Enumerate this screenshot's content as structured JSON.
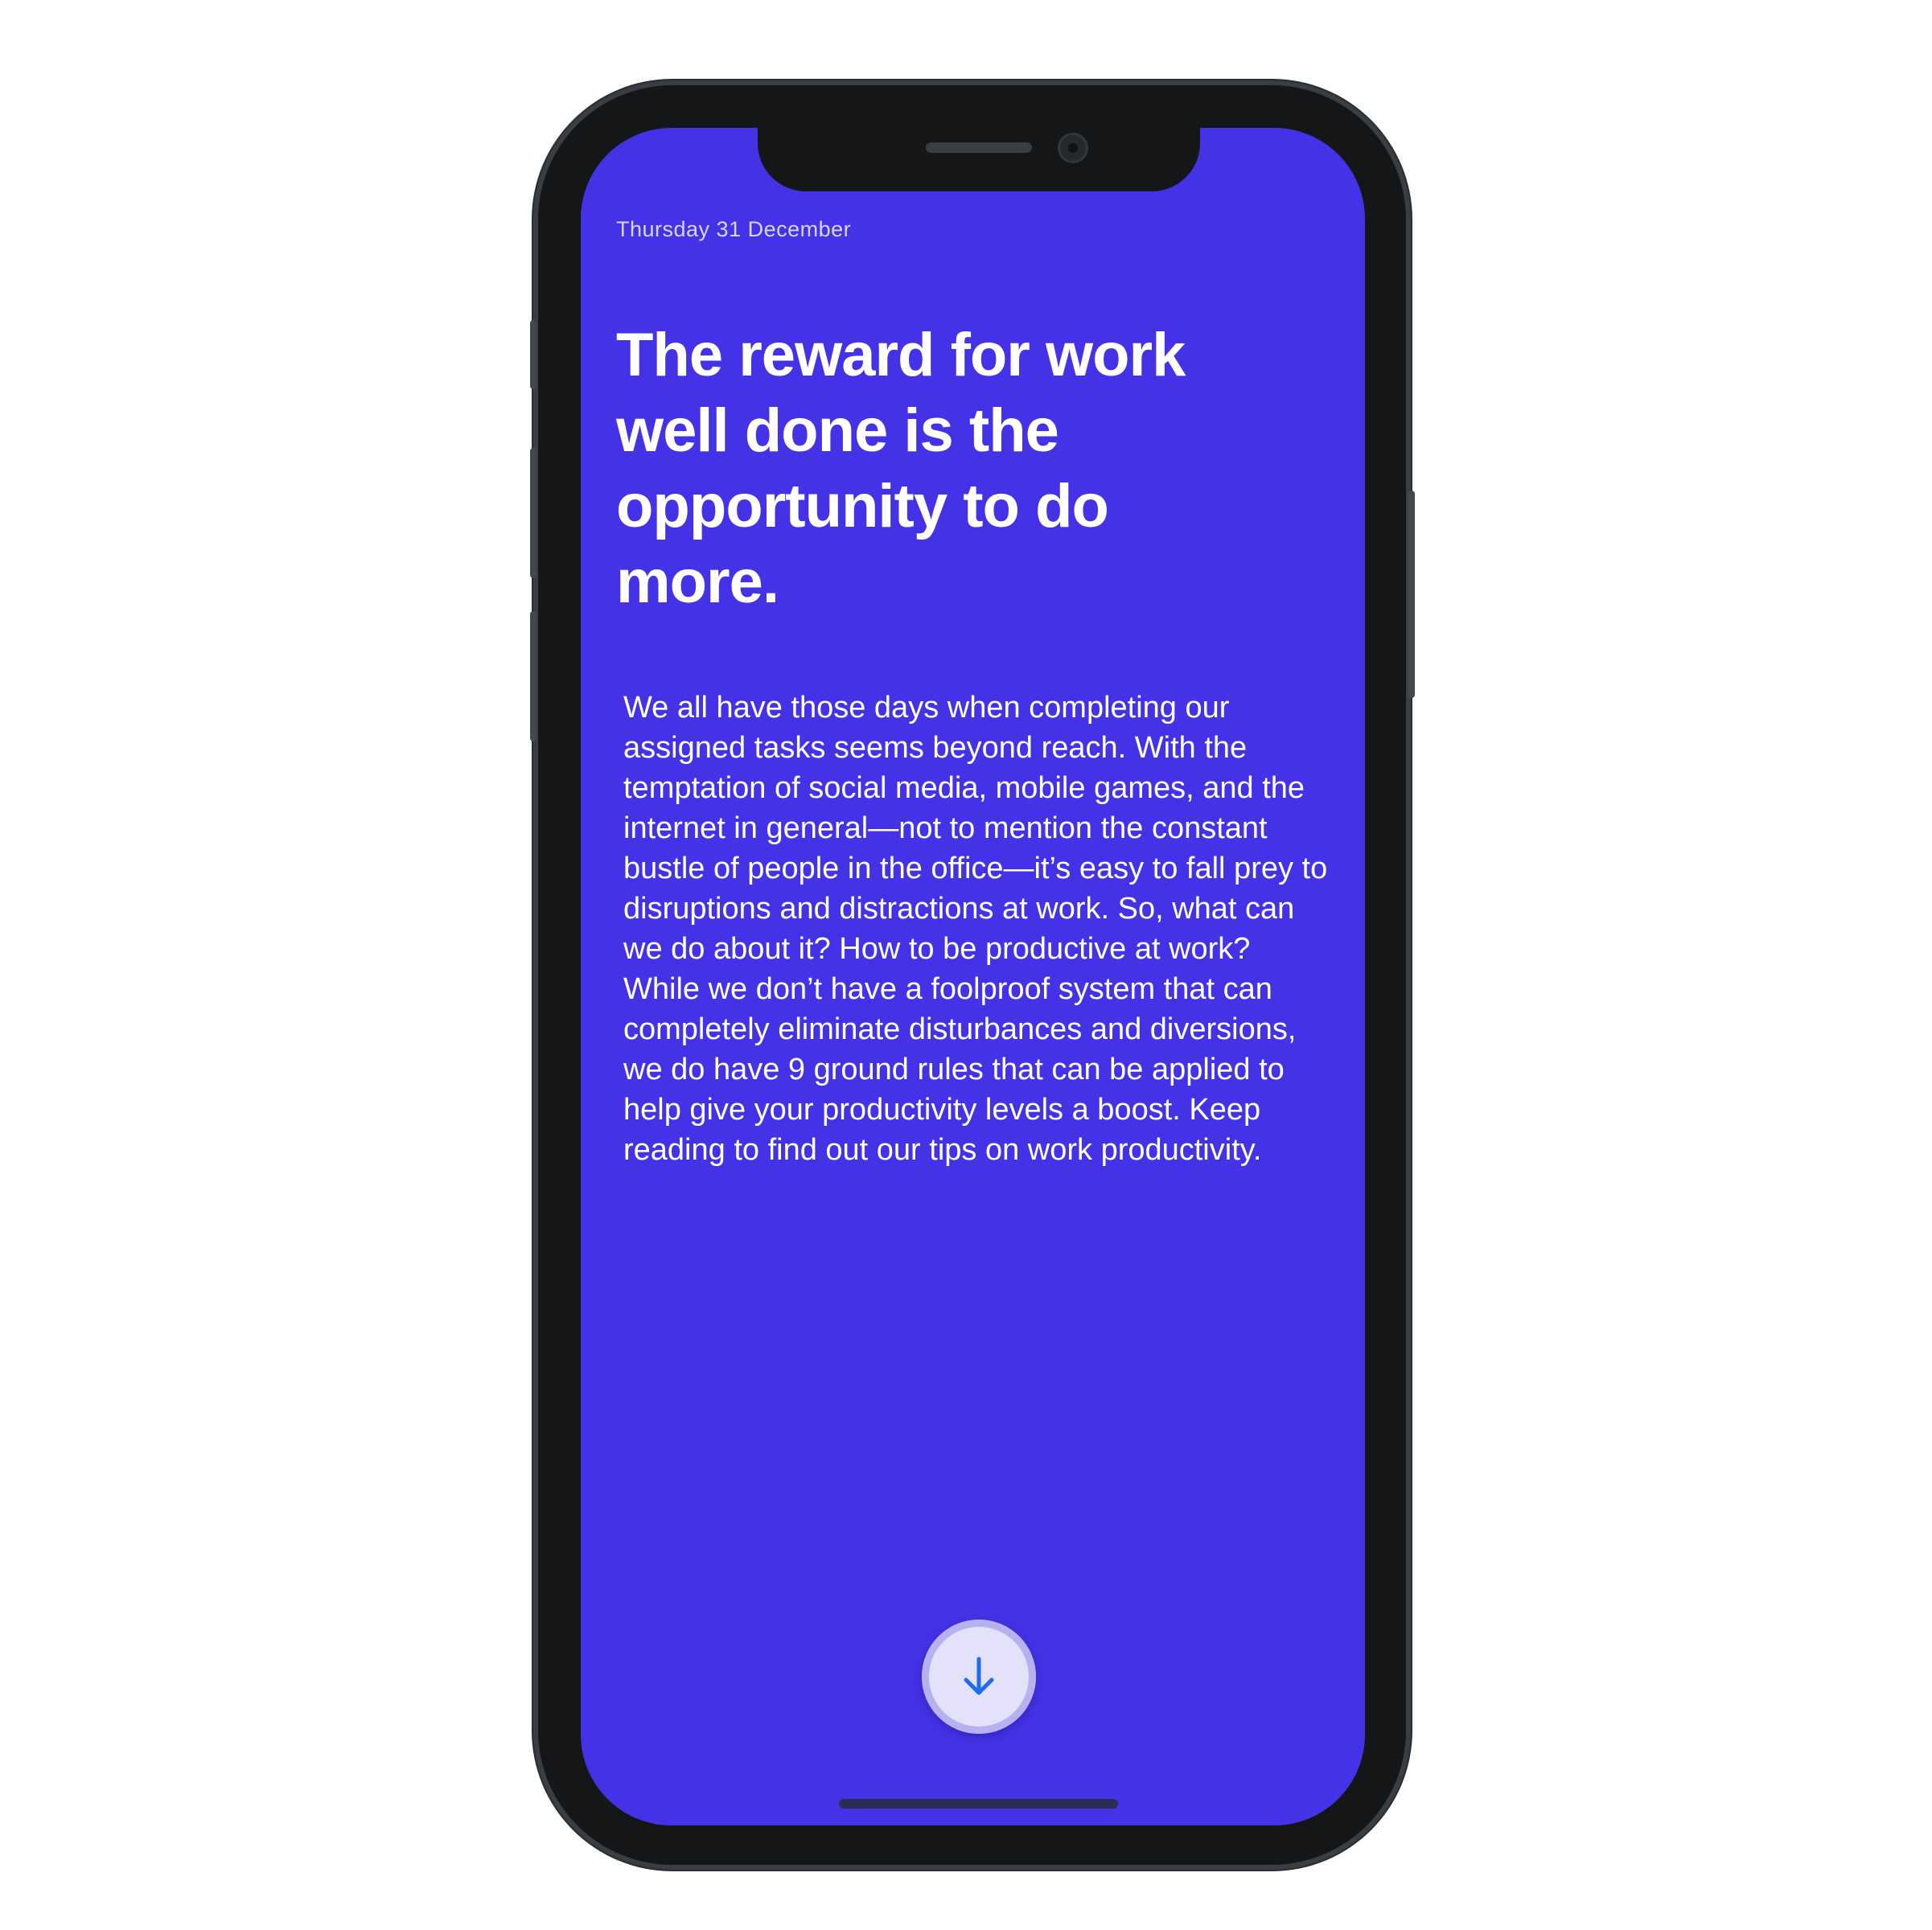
{
  "status": {
    "date": "Thursday 31 December"
  },
  "article": {
    "headline": "The reward for work well done is the opportunity to do more.",
    "body": "We all have those days when completing our assigned tasks seems beyond reach. With the temptation of social media, mobile games, and the internet in general—not to mention the constant bustle of people in the office—it’s easy to fall prey to disruptions and distractions at work. So, what can we do about it? How to be productive at work? While we don’t have a foolproof system that can completely eliminate disturbances and diversions, we do have 9 ground rules that can be applied to help give your productivity levels a boost. Keep reading to find out our tips on work productivity."
  },
  "controls": {
    "scroll_icon": "arrow-down-icon"
  },
  "colors": {
    "screen_background": "#4433e6",
    "text": "#ffffff",
    "accent_icon": "#1e6cf0"
  }
}
